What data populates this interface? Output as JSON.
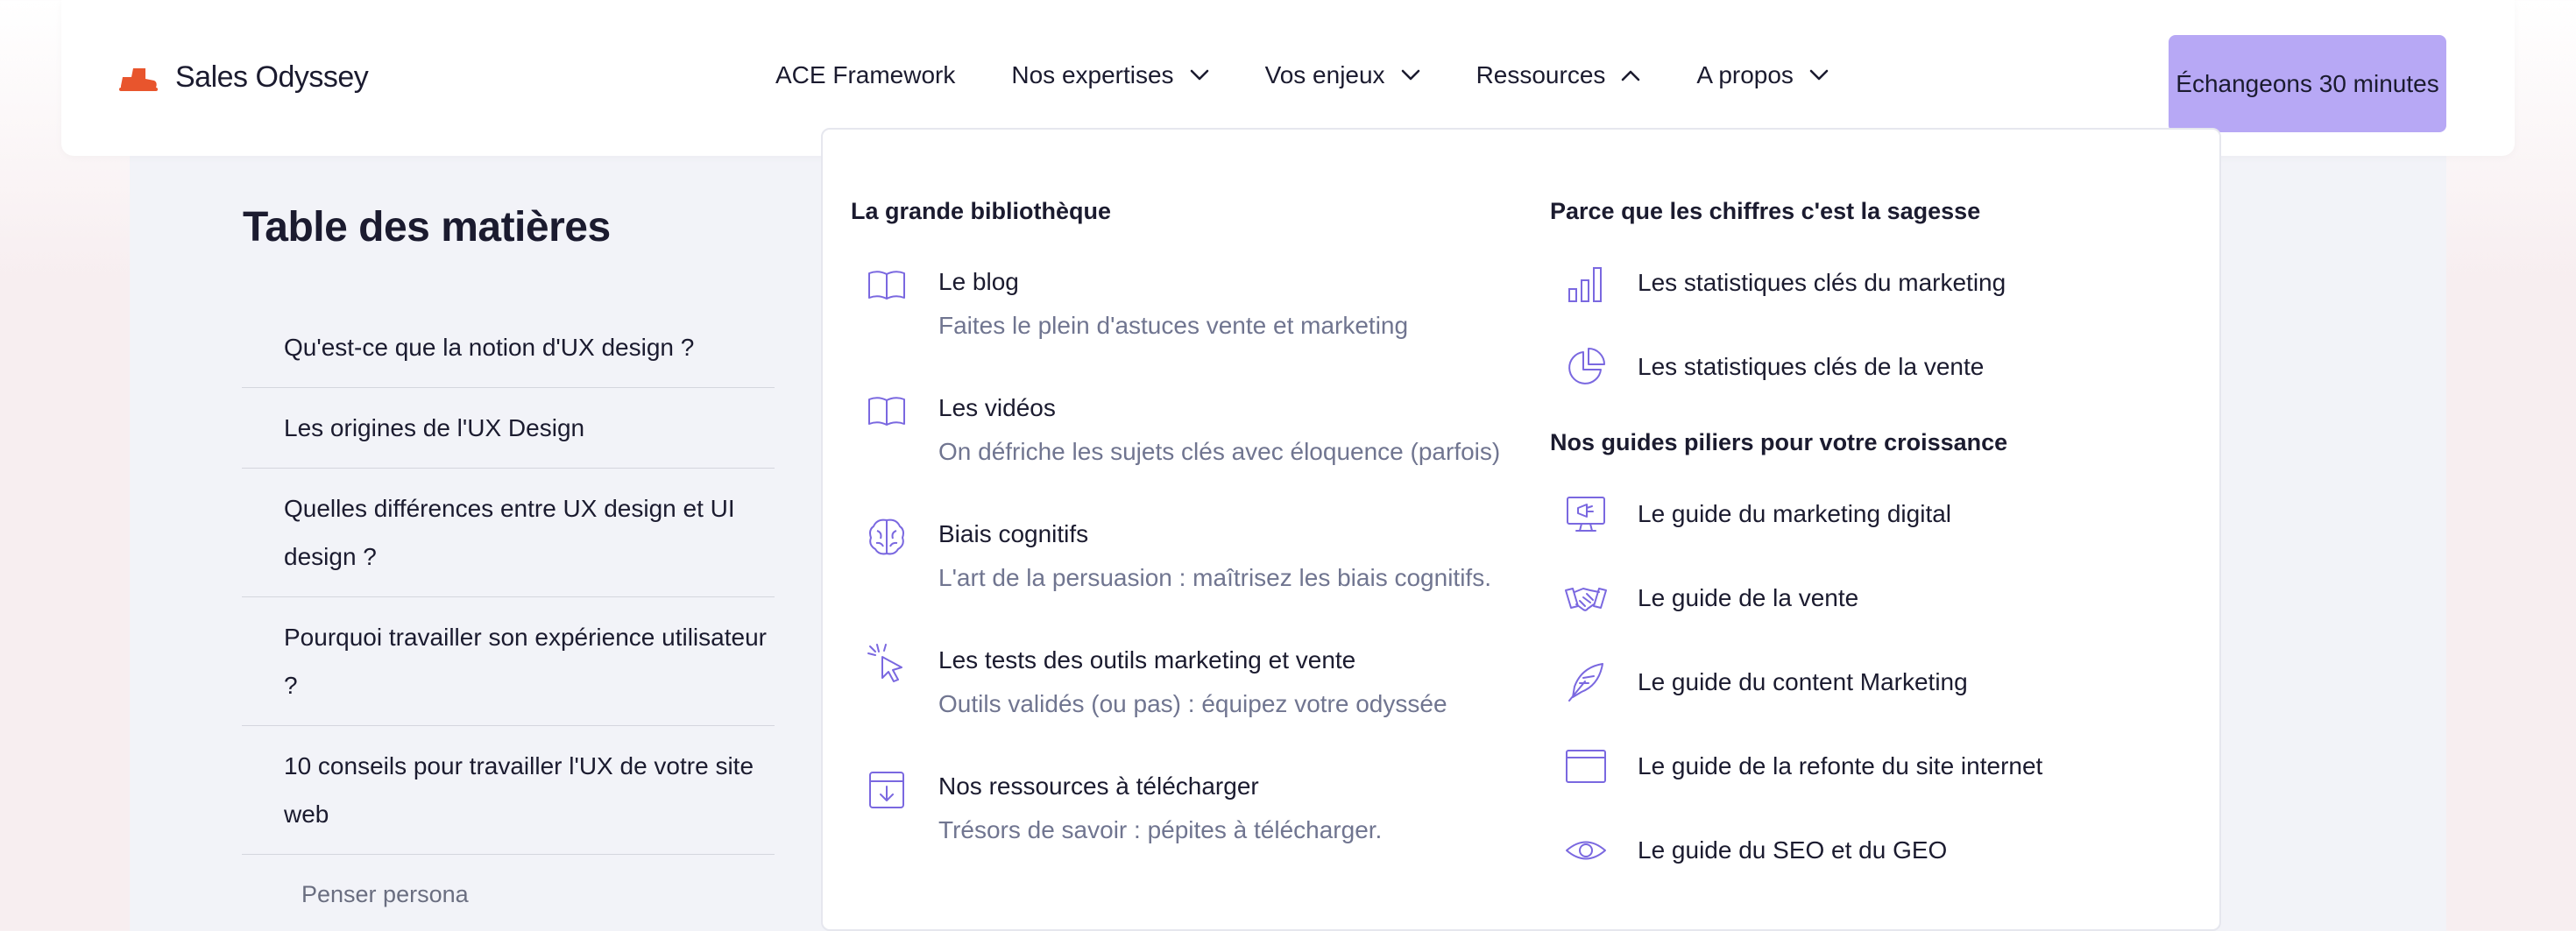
{
  "brand": {
    "name": "Sales Odyssey",
    "accent": "#e8552d"
  },
  "nav": {
    "items": [
      {
        "label": "ACE Framework",
        "icon": ""
      },
      {
        "label": "Nos expertises",
        "icon": "chevron-down-icon"
      },
      {
        "label": "Vos enjeux",
        "icon": "chevron-down-icon"
      },
      {
        "label": "Ressources",
        "icon": "chevron-up-icon"
      },
      {
        "label": "A propos",
        "icon": "chevron-down-icon"
      }
    ],
    "cta_label": "Échangeons 30 minutes",
    "cta_color": "#b7a8f5"
  },
  "toc": {
    "title": "Table des matières",
    "items": [
      "Qu'est-ce que la notion d'UX design ?",
      "Les origines de l'UX Design",
      "Quelles différences entre UX design et UI design ?",
      "Pourquoi travailler son expérience utilisateur ?",
      "10 conseils pour travailler l'UX de votre site web",
      "Penser persona"
    ]
  },
  "dropdown": {
    "left_title": "La grande bibliothèque",
    "left_items": [
      {
        "title": "Le blog",
        "desc": "Faites le plein d'astuces vente et marketing",
        "icon": "book-icon"
      },
      {
        "title": "Les vidéos",
        "desc": "On défriche les sujets clés avec éloquence (parfois)",
        "icon": "book-icon"
      },
      {
        "title": "Biais cognitifs",
        "desc": "L'art de la persuasion : maîtrisez les biais cognitifs.",
        "icon": "brain-icon"
      },
      {
        "title": "Les tests des outils marketing et vente",
        "desc": "Outils validés (ou pas) : équipez votre odyssée",
        "icon": "cursor-click-icon"
      },
      {
        "title": "Nos ressources à télécharger",
        "desc": "Trésors de savoir : pépites à télécharger.",
        "icon": "download-icon"
      }
    ],
    "right_title_1": "Parce que les chiffres c'est la sagesse",
    "stats": [
      {
        "title": "Les statistiques clés du marketing",
        "icon": "bar-chart-icon"
      },
      {
        "title": "Les statistiques clés de la vente",
        "icon": "pie-chart-icon"
      }
    ],
    "right_title_2": "Nos guides piliers pour votre croissance",
    "guides": [
      {
        "title": "Le guide du marketing digital",
        "icon": "monitor-megaphone-icon"
      },
      {
        "title": "Le guide de la vente",
        "icon": "handshake-icon"
      },
      {
        "title": "Le guide du content Marketing",
        "icon": "feather-pen-icon"
      },
      {
        "title": "Le guide de la refonte du site internet",
        "icon": "browser-window-icon"
      },
      {
        "title": "Le guide du SEO et du GEO",
        "icon": "eye-icon"
      }
    ],
    "icon_color": "#7a68e0"
  }
}
